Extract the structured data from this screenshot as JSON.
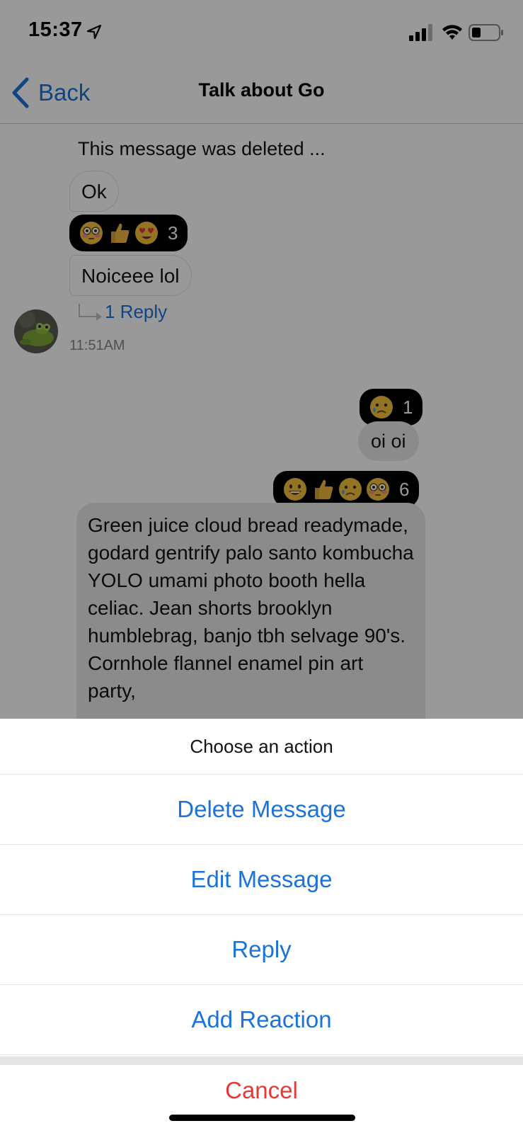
{
  "status_bar": {
    "time": "15:37",
    "icons": [
      "location-arrow-icon",
      "cellular-signal-icon",
      "wifi-icon",
      "battery-icon"
    ]
  },
  "nav": {
    "back_label": "Back",
    "title": "Talk about Go"
  },
  "messages": {
    "deleted_text": "This message was deleted ...",
    "ok_text": "Ok",
    "reactions_ok": {
      "emojis": [
        "flushed-face-emoji",
        "thumbs-up-emoji",
        "heart-eyes-emoji"
      ],
      "count": "3"
    },
    "noiceee_text": "Noiceee lol",
    "reply_link": "1 Reply",
    "timestamp": "11:51AM",
    "reactions_oi_top": {
      "emojis": [
        "sad-relieved-face-emoji"
      ],
      "count": "1"
    },
    "oi_text": "oi oi",
    "reactions_oi": {
      "emojis": [
        "grinning-face-emoji",
        "thumbs-up-emoji",
        "sad-relieved-face-emoji",
        "flushed-face-emoji"
      ],
      "count": "6"
    },
    "long_text": "Green juice cloud bread readymade, godard gentrify palo santo kombucha YOLO umami photo booth hella celiac. Jean shorts brooklyn humblebrag, banjo tbh selvage 90's. Cornhole flannel enamel pin art party,"
  },
  "action_sheet": {
    "title": "Choose an action",
    "actions": [
      "Delete Message",
      "Edit Message",
      "Reply",
      "Add Reaction"
    ],
    "cancel": "Cancel"
  },
  "colors": {
    "accent_blue": "#1a73d9",
    "cancel_red": "#e53935",
    "reaction_pill_bg": "#000000",
    "outgoing_bubble_bg": "#e8e8e8",
    "overlay": "rgba(0,0,0,0.40)"
  }
}
